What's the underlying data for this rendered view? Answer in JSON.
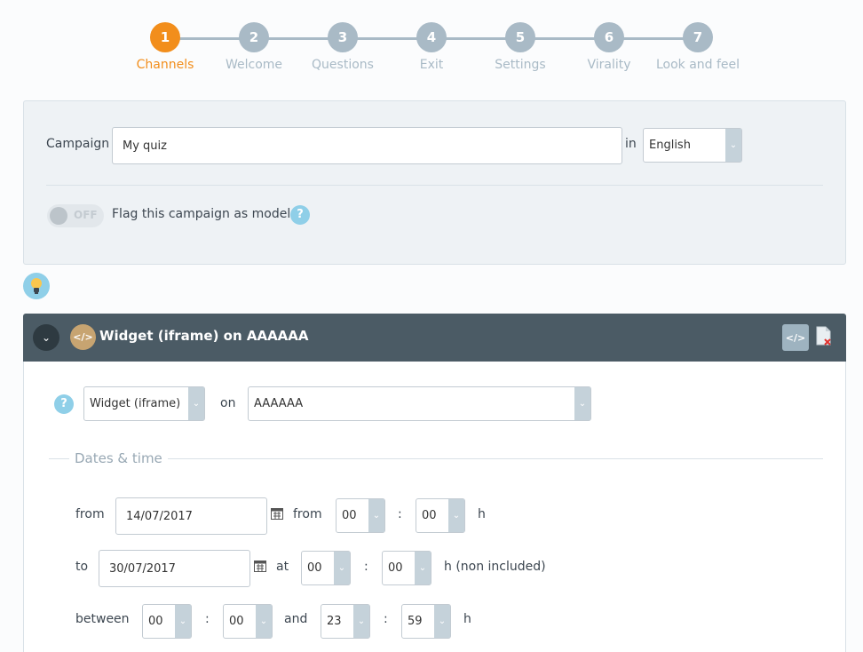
{
  "stepper": {
    "steps": [
      {
        "num": "1",
        "label": "Channels",
        "active": true
      },
      {
        "num": "2",
        "label": "Welcome"
      },
      {
        "num": "3",
        "label": "Questions"
      },
      {
        "num": "4",
        "label": "Exit"
      },
      {
        "num": "5",
        "label": "Settings"
      },
      {
        "num": "6",
        "label": "Virality"
      },
      {
        "num": "7",
        "label": "Look and feel"
      }
    ]
  },
  "campaign": {
    "label": "Campaign",
    "value": "My quiz",
    "in_label": "in",
    "language": "English",
    "toggle_text": "OFF",
    "flag_label": "Flag this campaign as model",
    "help": "?"
  },
  "channel": {
    "title": "Widget (iframe) on AAAAAA",
    "code_symbol": "</>",
    "type_value": "Widget (iframe)",
    "on_label": "on",
    "site_value": "AAAAAA",
    "help": "?"
  },
  "dates": {
    "section_title": "Dates & time",
    "from_label": "from",
    "from_date": "14/07/2017",
    "from_time_label": "from",
    "from_hour": "00",
    "from_minute": "00",
    "colon": ":",
    "h": "h",
    "to_label": "to",
    "to_date": "30/07/2017",
    "at_label": "at",
    "to_hour": "00",
    "to_minute": "00",
    "h_non_included": "h (non included)",
    "between_label": "between",
    "between_start_hour": "00",
    "between_start_minute": "00",
    "and_label": "and",
    "between_end_hour": "23",
    "between_end_minute": "59"
  },
  "colors": {
    "accent": "#f28e1c",
    "step_inactive": "#a9bac6",
    "header_bg": "#4b5b65",
    "help": "#8fcfe8"
  }
}
